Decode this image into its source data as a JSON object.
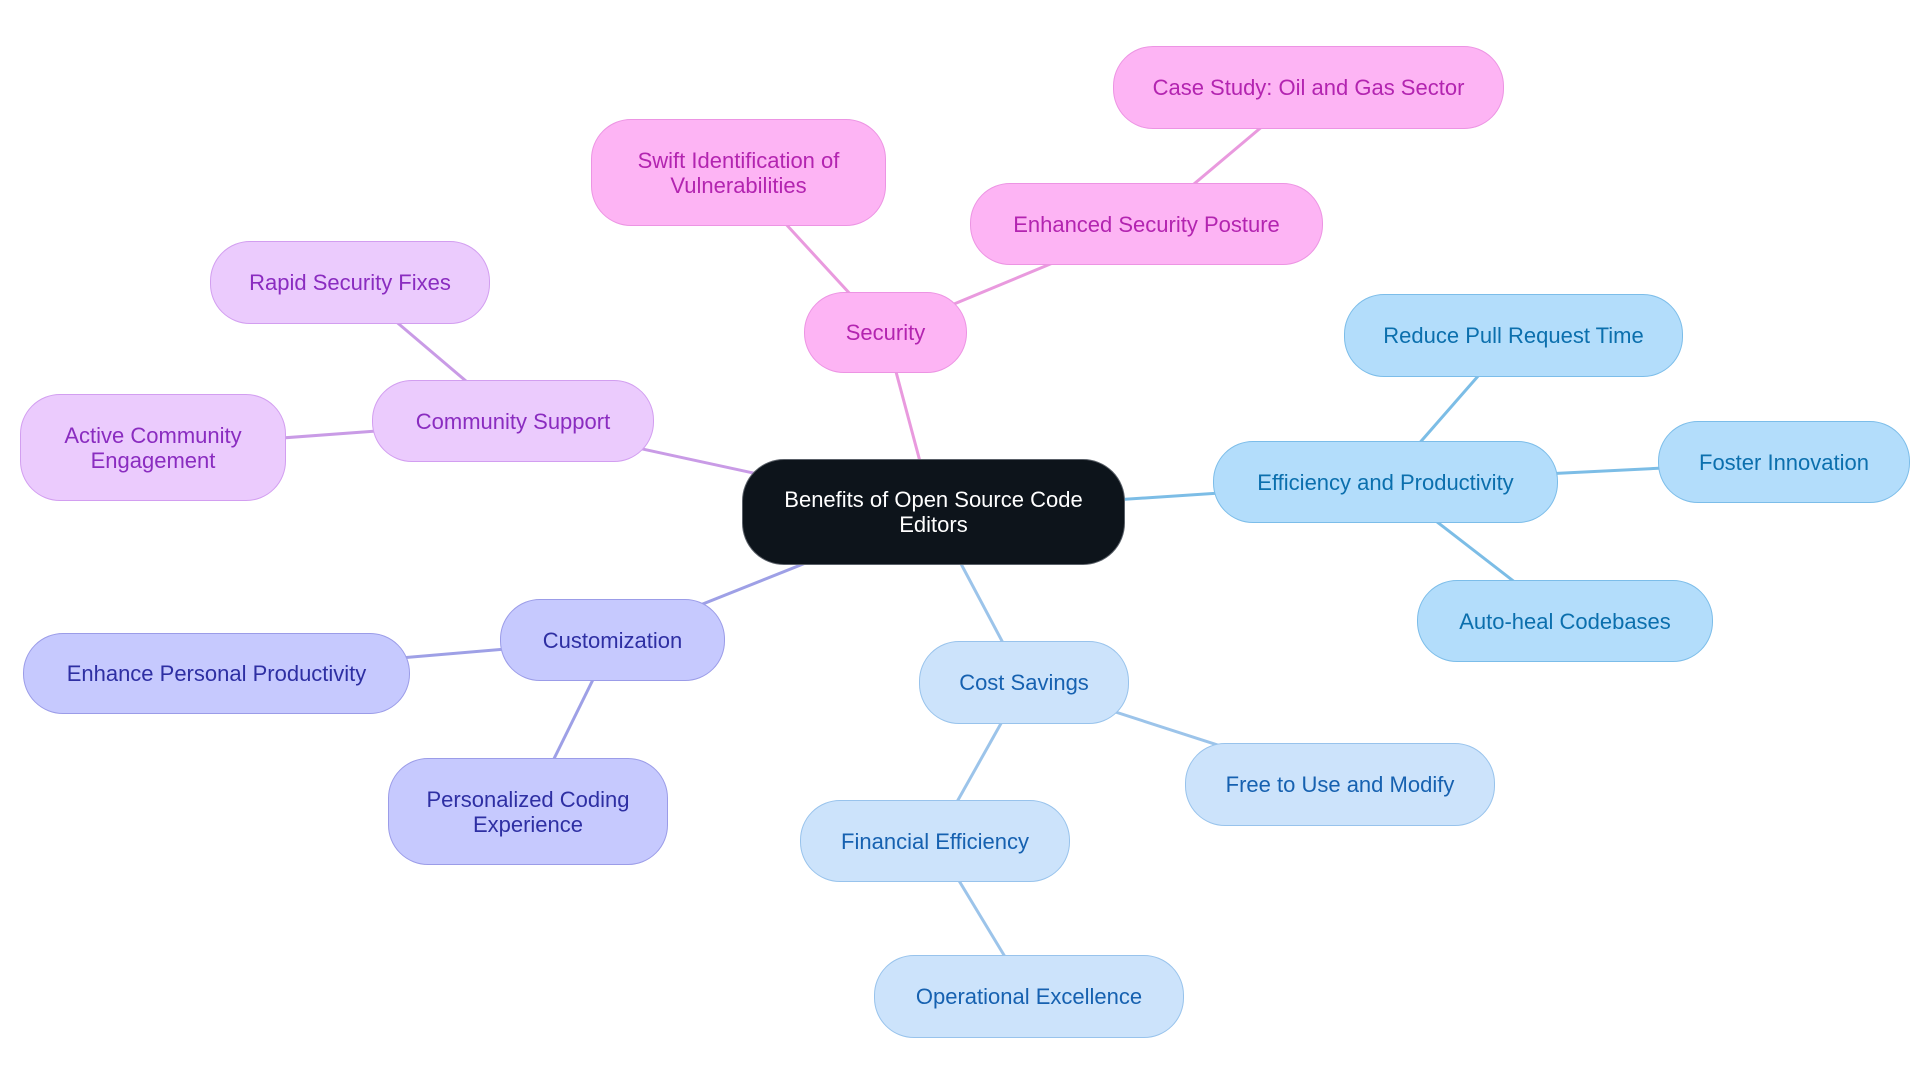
{
  "title": "Benefits of Open Source Code Editors",
  "colors": {
    "root": "#0d141b",
    "security": "#fdb4f4",
    "security_edge": "#e99ade",
    "community": "#ebcbfd",
    "community_edge": "#c99be6",
    "customization": "#c6c9fe",
    "customization_edge": "#9ea0e6",
    "efficiency": "#b3ddfb",
    "efficiency_edge": "#7cbde6",
    "cost": "#cce3fb",
    "cost_edge": "#9cc4ea"
  },
  "nodes": {
    "root": "Benefits of Open Source Code Editors",
    "security": "Security",
    "swift": "Swift Identification of Vulnerabilities",
    "posture": "Enhanced Security Posture",
    "case_study": "Case Study: Oil and Gas Sector",
    "community": "Community Support",
    "rapid": "Rapid Security Fixes",
    "active": "Active Community Engagement",
    "customization": "Customization",
    "enhance": "Enhance Personal Productivity",
    "personalized": "Personalized Coding Experience",
    "efficiency": "Efficiency and Productivity",
    "reduce": "Reduce Pull Request Time",
    "foster": "Foster Innovation",
    "autoheal": "Auto-heal Codebases",
    "cost": "Cost Savings",
    "free": "Free to Use and Modify",
    "financial": "Financial Efficiency",
    "operational": "Operational Excellence"
  },
  "edges": [
    [
      "root",
      "security",
      "security_edge"
    ],
    [
      "security",
      "swift",
      "security_edge"
    ],
    [
      "security",
      "posture",
      "security_edge"
    ],
    [
      "posture",
      "case_study",
      "security_edge"
    ],
    [
      "root",
      "community",
      "community_edge"
    ],
    [
      "community",
      "rapid",
      "community_edge"
    ],
    [
      "community",
      "active",
      "community_edge"
    ],
    [
      "root",
      "customization",
      "customization_edge"
    ],
    [
      "customization",
      "enhance",
      "customization_edge"
    ],
    [
      "customization",
      "personalized",
      "customization_edge"
    ],
    [
      "root",
      "efficiency",
      "efficiency_edge"
    ],
    [
      "efficiency",
      "reduce",
      "efficiency_edge"
    ],
    [
      "efficiency",
      "foster",
      "efficiency_edge"
    ],
    [
      "efficiency",
      "autoheal",
      "efficiency_edge"
    ],
    [
      "root",
      "cost",
      "cost_edge"
    ],
    [
      "cost",
      "free",
      "cost_edge"
    ],
    [
      "cost",
      "financial",
      "cost_edge"
    ],
    [
      "financial",
      "operational",
      "cost_edge"
    ]
  ]
}
